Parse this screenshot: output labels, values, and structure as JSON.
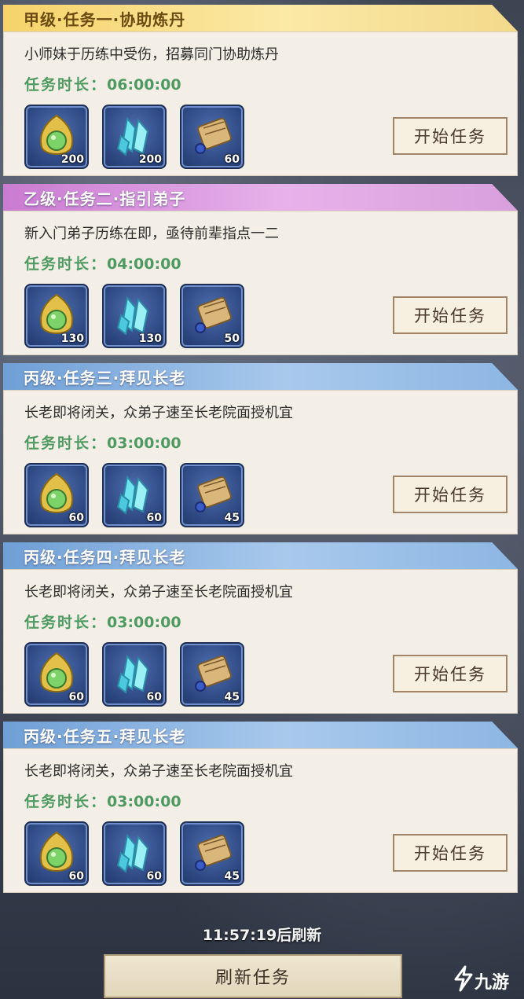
{
  "tasks": [
    {
      "title": "甲级·任务一·协助炼丹",
      "desc": "小师妹于历练中受伤，招募同门协助炼丹",
      "duration_label": "任务时长：",
      "duration": "06:00:00",
      "rewards": [
        {
          "icon": "pill-icon",
          "qty": "200"
        },
        {
          "icon": "crystal-icon",
          "qty": "200"
        },
        {
          "icon": "scroll-icon",
          "qty": "60"
        }
      ],
      "button": "开始任务",
      "tier_color": "#f6d36a"
    },
    {
      "title": "乙级·任务二·指引弟子",
      "desc": "新入门弟子历练在即，亟待前辈指点一二",
      "duration_label": "任务时长：",
      "duration": "04:00:00",
      "rewards": [
        {
          "icon": "pill-icon",
          "qty": "130"
        },
        {
          "icon": "crystal-icon",
          "qty": "130"
        },
        {
          "icon": "scroll-icon",
          "qty": "50"
        }
      ],
      "button": "开始任务",
      "tier_color": "#c97bd1"
    },
    {
      "title": "丙级·任务三·拜见长老",
      "desc": "长老即将闭关，众弟子速至长老院面授机宜",
      "duration_label": "任务时长：",
      "duration": "03:00:00",
      "rewards": [
        {
          "icon": "pill-icon",
          "qty": "60"
        },
        {
          "icon": "crystal-icon",
          "qty": "60"
        },
        {
          "icon": "scroll-icon",
          "qty": "45"
        }
      ],
      "button": "开始任务",
      "tier_color": "#6f9fd6"
    },
    {
      "title": "丙级·任务四·拜见长老",
      "desc": "长老即将闭关，众弟子速至长老院面授机宜",
      "duration_label": "任务时长：",
      "duration": "03:00:00",
      "rewards": [
        {
          "icon": "pill-icon",
          "qty": "60"
        },
        {
          "icon": "crystal-icon",
          "qty": "60"
        },
        {
          "icon": "scroll-icon",
          "qty": "45"
        }
      ],
      "button": "开始任务",
      "tier_color": "#6f9fd6"
    },
    {
      "title": "丙级·任务五·拜见长老",
      "desc": "长老即将闭关，众弟子速至长老院面授机宜",
      "duration_label": "任务时长：",
      "duration": "03:00:00",
      "rewards": [
        {
          "icon": "pill-icon",
          "qty": "60"
        },
        {
          "icon": "crystal-icon",
          "qty": "60"
        },
        {
          "icon": "scroll-icon",
          "qty": "45"
        }
      ],
      "button": "开始任务",
      "tier_color": "#6f9fd6"
    }
  ],
  "footer": {
    "refresh_timer": "11:57:19后刷新",
    "refresh_button": "刷新任务"
  },
  "watermark": {
    "text": "九游",
    "icon": "jiuyou-logo-icon"
  }
}
